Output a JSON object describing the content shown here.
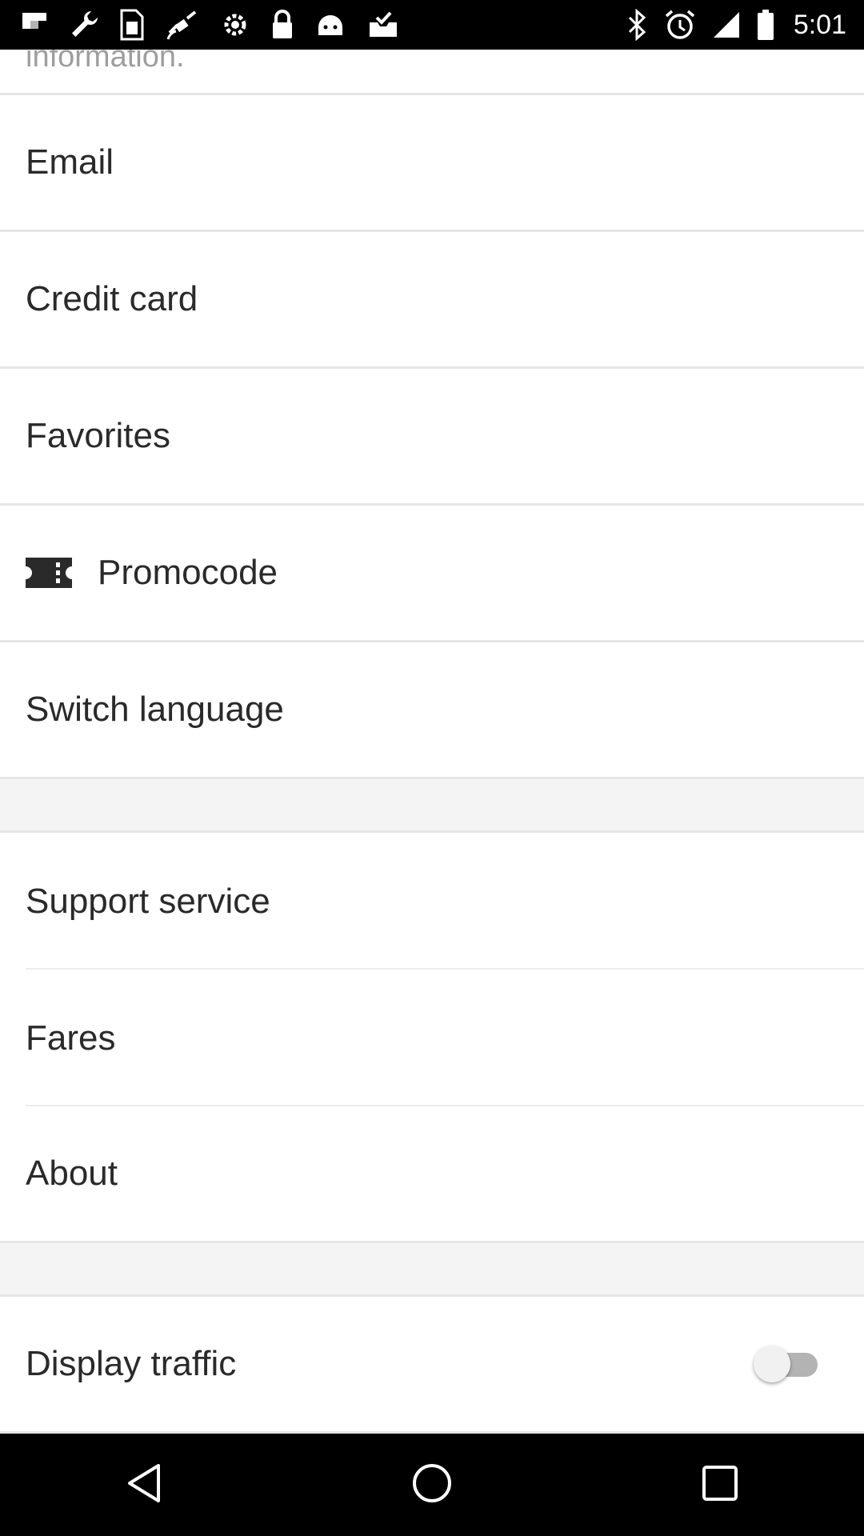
{
  "status_bar": {
    "time": "5:01",
    "left_icons": [
      "flipboard-icon",
      "wrench-icon",
      "sim-icon",
      "fake-gps-icon",
      "settings-icon",
      "lock-icon",
      "android-icon",
      "inbox-check-icon"
    ],
    "right_icons": [
      "bluetooth-icon",
      "alarm-icon",
      "signal-icon",
      "battery-icon"
    ]
  },
  "menu": {
    "cut_off_text": "information.",
    "items": [
      {
        "label": "Email"
      },
      {
        "label": "Credit card"
      },
      {
        "label": "Favorites"
      },
      {
        "label": "Promocode",
        "icon": "ticket-icon"
      },
      {
        "label": "Switch language"
      }
    ],
    "info_items": [
      {
        "label": "Support service"
      },
      {
        "label": "Fares"
      },
      {
        "label": "About"
      }
    ],
    "settings_items": [
      {
        "label": "Display traffic",
        "toggle_on": false
      }
    ]
  },
  "nav_bar": {
    "buttons": [
      "back-icon",
      "home-icon",
      "recents-icon"
    ]
  },
  "colors": {
    "text": "#2a2a2a",
    "divider": "#e6e6e6",
    "section_background": "#f4f4f4",
    "toggle_track": "#b3b3b3",
    "toggle_knob": "#f1f1f1"
  }
}
